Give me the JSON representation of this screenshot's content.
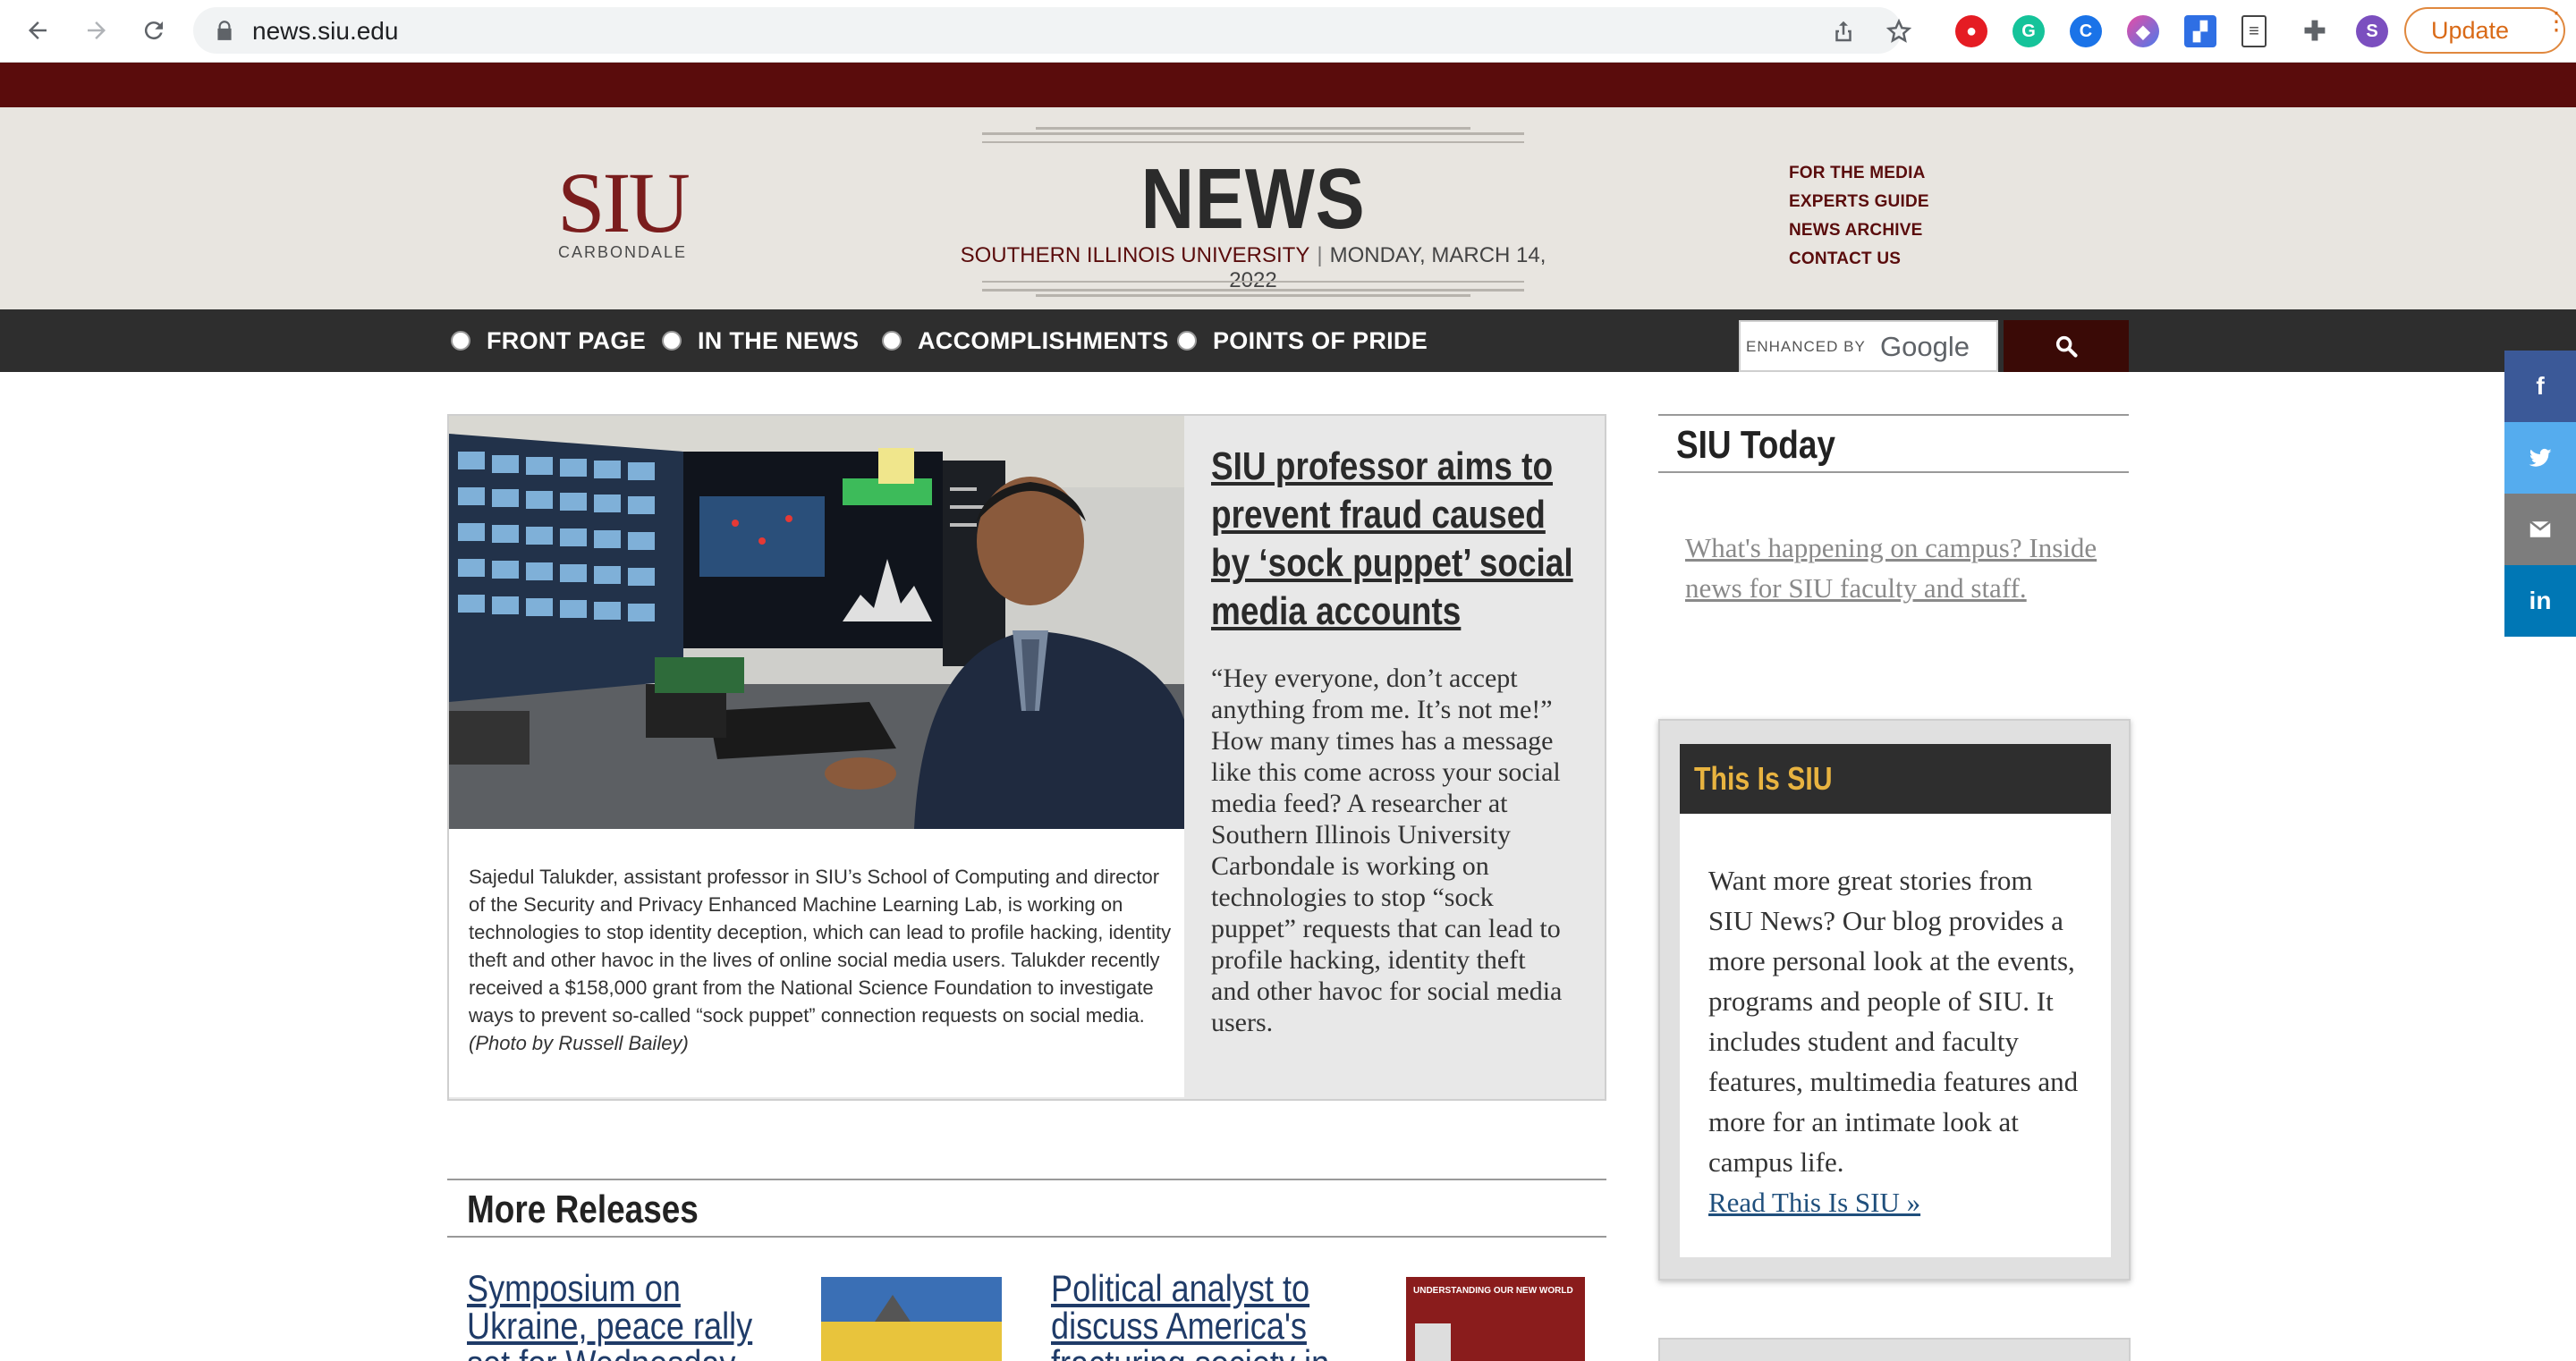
{
  "browser": {
    "url": "news.siu.edu",
    "update_label": "Update",
    "profile_initial": "S"
  },
  "site": {
    "logo_text": "SIU",
    "logo_sub": "CARBONDALE",
    "masthead_title": "NEWS",
    "university": "SOUTHERN ILLINOIS UNIVERSITY",
    "date": "MONDAY, MARCH 14, 2022",
    "utility_links": [
      "FOR THE MEDIA",
      "EXPERTS GUIDE",
      "NEWS ARCHIVE",
      "CONTACT US"
    ],
    "nav": [
      "FRONT PAGE",
      "IN THE NEWS",
      "ACCOMPLISHMENTS",
      "POINTS OF PRIDE"
    ],
    "search": {
      "enhanced_by": "ENHANCED BY",
      "google": "Google"
    }
  },
  "feature": {
    "headline": "SIU professor aims to prevent fraud caused by ‘sock puppet’ social media accounts",
    "body": "“Hey everyone, don’t accept anything from me. It’s not me!” How many times has a message like this come across your social media feed? A researcher at Southern Illinois University Carbondale is working on technologies to stop “sock puppet” requests that can lead to profile hacking, identity theft and other havoc for social media users.",
    "caption": "Sajedul Talukder, assistant professor in SIU’s School of Computing and director of the Security and Privacy Enhanced Machine Learning Lab, is working on technologies to stop identity deception, which can lead to profile hacking, identity theft and other havoc in the lives of online social media users. Talukder recently received a $158,000 grant from the National Science Foundation to investigate ways to prevent so-called “sock puppet” connection requests on social media.",
    "credit": "(Photo by Russell Bailey)"
  },
  "more_releases": {
    "heading": "More Releases",
    "items": [
      {
        "title": "Symposium on Ukraine, peace rally set for Wednesday"
      },
      {
        "title": "Political analyst to discuss America's fracturing society in"
      }
    ],
    "thumb_text": "UNDERSTANDING OUR NEW WORLD"
  },
  "sidebar": {
    "siu_today_heading": "SIU Today",
    "siu_today_link": "What's happening on campus? Inside news for SIU faculty and staff.",
    "this_is_siu_heading": "This Is SIU",
    "this_is_siu_body": "Want more great stories from SIU News? Our blog provides a more personal look at the events, programs and people of SIU. It includes student and faculty features, multimedia features and more for an intimate look at campus life.",
    "this_is_siu_link": "Read This Is SIU »"
  },
  "share": {
    "facebook": "f",
    "linkedin": "in"
  },
  "colors": {
    "maroon": "#5a0c0c",
    "masthead_bg": "#e8e5e0",
    "navbar_bg": "#2e2e2e",
    "facebook": "#3b5998",
    "twitter": "#55acee",
    "email": "#7d7d7d",
    "linkedin": "#0077b5",
    "gold": "#e8b340"
  }
}
